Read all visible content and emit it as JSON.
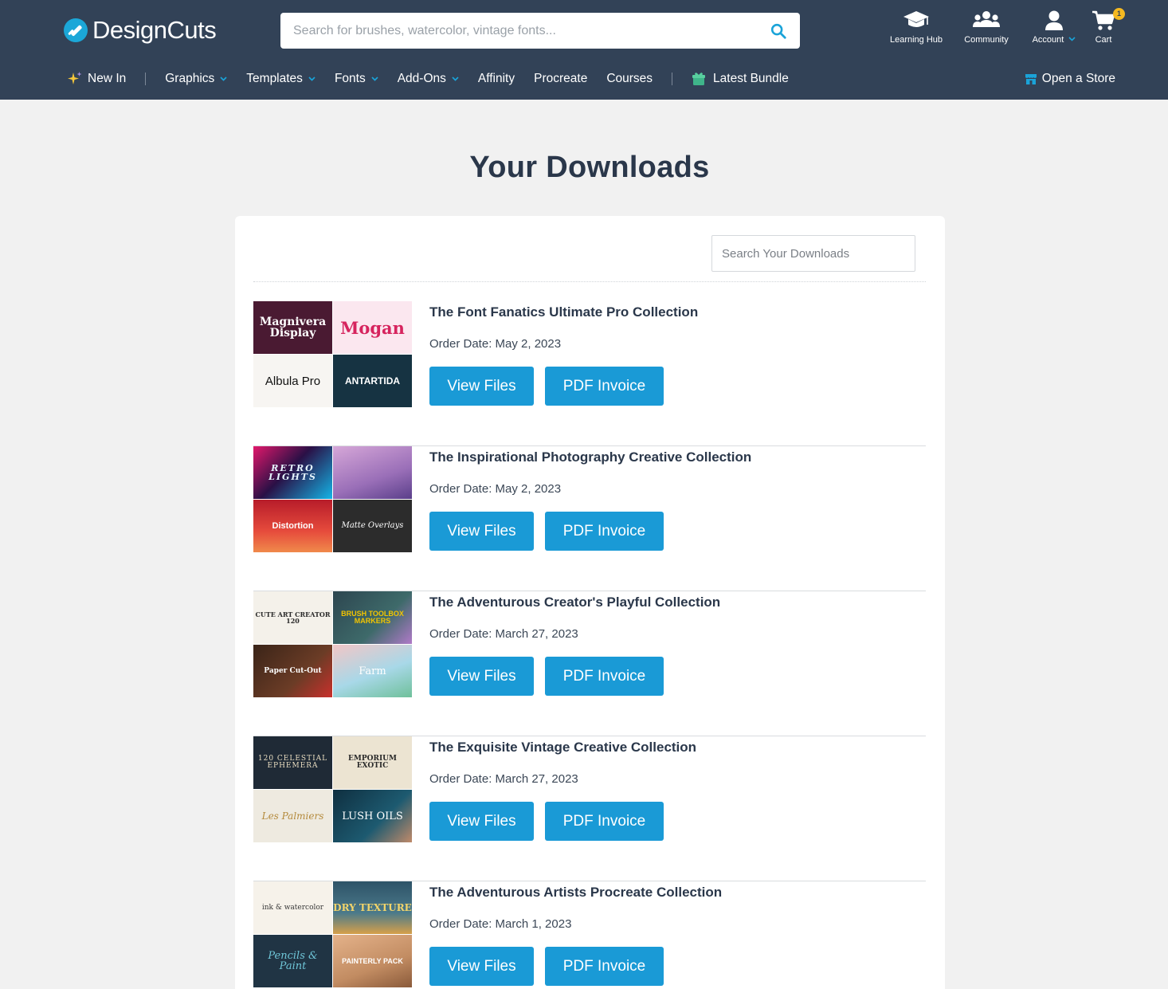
{
  "brand": {
    "name": "DesignCuts",
    "accent": "#1a9ad6",
    "header_bg": "#324257"
  },
  "search": {
    "placeholder": "Search for brushes, watercolor, vintage fonts..."
  },
  "top_icons": {
    "learning_hub": "Learning Hub",
    "community": "Community",
    "account": "Account",
    "cart": "Cart",
    "cart_count": "1"
  },
  "nav": {
    "new_in": "New In",
    "graphics": "Graphics",
    "templates": "Templates",
    "fonts": "Fonts",
    "add_ons": "Add-Ons",
    "affinity": "Affinity",
    "procreate": "Procreate",
    "courses": "Courses",
    "latest_bundle": "Latest Bundle",
    "open_store": "Open a Store"
  },
  "page": {
    "title": "Your Downloads",
    "search_placeholder": "Search Your Downloads"
  },
  "orders": [
    {
      "title": "The Font Fanatics Ultimate Pro Collection",
      "date": "Order Date: May 2, 2023",
      "view_label": "View Files",
      "pdf_label": "PDF Invoice",
      "thumbs": [
        {
          "text": "Magnivera Display",
          "bg": "#4a1a32",
          "fg": "#ffffff"
        },
        {
          "text": "Mogan",
          "bg": "#fbe7ef",
          "fg": "#d6245e"
        },
        {
          "text": "Albula Pro",
          "bg": "#f7f5f2",
          "fg": "#111111"
        },
        {
          "text": "ANTARTIDA",
          "bg": "#163342",
          "fg": "#ffffff"
        }
      ]
    },
    {
      "title": "The Inspirational Photography Creative Collection",
      "date": "Order Date: May 2, 2023",
      "view_label": "View Files",
      "pdf_label": "PDF Invoice",
      "thumbs": [
        {
          "text": "RETRO LIGHTS",
          "bg": "#2a1046",
          "fg": "#e6f6ff"
        },
        {
          "text": "",
          "bg": "#9a6fb8",
          "fg": "#ffffff"
        },
        {
          "text": "Distortion",
          "bg": "#cf2630",
          "fg": "#ffffff"
        },
        {
          "text": "Matte Overlays",
          "bg": "#2c2c2c",
          "fg": "#ffffff"
        }
      ]
    },
    {
      "title": "The Adventurous Creator's Playful Collection",
      "date": "Order Date: March 27, 2023",
      "view_label": "View Files",
      "pdf_label": "PDF Invoice",
      "thumbs": [
        {
          "text": "CUTE ART CREATOR 120",
          "bg": "#f4f1ea",
          "fg": "#2a2a2a"
        },
        {
          "text": "BRUSH TOOLBOX MARKERS",
          "bg": "#2d4650",
          "fg": "#f2c400"
        },
        {
          "text": "Paper Cut-Out",
          "bg": "#5a3524",
          "fg": "#ffffff"
        },
        {
          "text": "Farm",
          "bg": "#a8d8e8",
          "fg": "#ffffff"
        }
      ]
    },
    {
      "title": "The Exquisite Vintage Creative Collection",
      "date": "Order Date: March 27, 2023",
      "view_label": "View Files",
      "pdf_label": "PDF Invoice",
      "thumbs": [
        {
          "text": "120 CELESTIAL EPHEMERA",
          "bg": "#1f2a36",
          "fg": "#e8dcc0"
        },
        {
          "text": "EMPORIUM EXOTIC",
          "bg": "#ece4d2",
          "fg": "#2a2a2a"
        },
        {
          "text": "Les Palmiers",
          "bg": "#eeeae0",
          "fg": "#b48a3c"
        },
        {
          "text": "LUSH OILS",
          "bg": "#163c50",
          "fg": "#ffffff"
        }
      ]
    },
    {
      "title": "The Adventurous Artists Procreate Collection",
      "date": "Order Date: March 1, 2023",
      "view_label": "View Files",
      "pdf_label": "PDF Invoice",
      "thumbs": [
        {
          "text": "ink & watercolor",
          "bg": "#f6f2ea",
          "fg": "#3a3a3a"
        },
        {
          "text": "DRY TEXTURE",
          "bg": "#2e5368",
          "fg": "#f2d46a"
        },
        {
          "text": "Pencils & Paint",
          "bg": "#203444",
          "fg": "#6fc6d8"
        },
        {
          "text": "PAINTERLY PACK",
          "bg": "#c28c62",
          "fg": "#ffffff"
        }
      ]
    }
  ]
}
